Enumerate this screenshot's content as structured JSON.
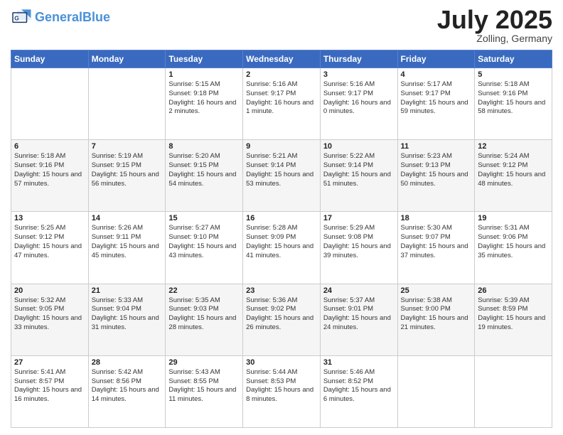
{
  "logo": {
    "line1": "General",
    "line2": "Blue"
  },
  "title": "July 2025",
  "location": "Zolling, Germany",
  "days_of_week": [
    "Sunday",
    "Monday",
    "Tuesday",
    "Wednesday",
    "Thursday",
    "Friday",
    "Saturday"
  ],
  "weeks": [
    [
      {
        "day": "",
        "text": ""
      },
      {
        "day": "",
        "text": ""
      },
      {
        "day": "1",
        "text": "Sunrise: 5:15 AM\nSunset: 9:18 PM\nDaylight: 16 hours\nand 2 minutes."
      },
      {
        "day": "2",
        "text": "Sunrise: 5:16 AM\nSunset: 9:17 PM\nDaylight: 16 hours\nand 1 minute."
      },
      {
        "day": "3",
        "text": "Sunrise: 5:16 AM\nSunset: 9:17 PM\nDaylight: 16 hours\nand 0 minutes."
      },
      {
        "day": "4",
        "text": "Sunrise: 5:17 AM\nSunset: 9:17 PM\nDaylight: 15 hours\nand 59 minutes."
      },
      {
        "day": "5",
        "text": "Sunrise: 5:18 AM\nSunset: 9:16 PM\nDaylight: 15 hours\nand 58 minutes."
      }
    ],
    [
      {
        "day": "6",
        "text": "Sunrise: 5:18 AM\nSunset: 9:16 PM\nDaylight: 15 hours\nand 57 minutes."
      },
      {
        "day": "7",
        "text": "Sunrise: 5:19 AM\nSunset: 9:15 PM\nDaylight: 15 hours\nand 56 minutes."
      },
      {
        "day": "8",
        "text": "Sunrise: 5:20 AM\nSunset: 9:15 PM\nDaylight: 15 hours\nand 54 minutes."
      },
      {
        "day": "9",
        "text": "Sunrise: 5:21 AM\nSunset: 9:14 PM\nDaylight: 15 hours\nand 53 minutes."
      },
      {
        "day": "10",
        "text": "Sunrise: 5:22 AM\nSunset: 9:14 PM\nDaylight: 15 hours\nand 51 minutes."
      },
      {
        "day": "11",
        "text": "Sunrise: 5:23 AM\nSunset: 9:13 PM\nDaylight: 15 hours\nand 50 minutes."
      },
      {
        "day": "12",
        "text": "Sunrise: 5:24 AM\nSunset: 9:12 PM\nDaylight: 15 hours\nand 48 minutes."
      }
    ],
    [
      {
        "day": "13",
        "text": "Sunrise: 5:25 AM\nSunset: 9:12 PM\nDaylight: 15 hours\nand 47 minutes."
      },
      {
        "day": "14",
        "text": "Sunrise: 5:26 AM\nSunset: 9:11 PM\nDaylight: 15 hours\nand 45 minutes."
      },
      {
        "day": "15",
        "text": "Sunrise: 5:27 AM\nSunset: 9:10 PM\nDaylight: 15 hours\nand 43 minutes."
      },
      {
        "day": "16",
        "text": "Sunrise: 5:28 AM\nSunset: 9:09 PM\nDaylight: 15 hours\nand 41 minutes."
      },
      {
        "day": "17",
        "text": "Sunrise: 5:29 AM\nSunset: 9:08 PM\nDaylight: 15 hours\nand 39 minutes."
      },
      {
        "day": "18",
        "text": "Sunrise: 5:30 AM\nSunset: 9:07 PM\nDaylight: 15 hours\nand 37 minutes."
      },
      {
        "day": "19",
        "text": "Sunrise: 5:31 AM\nSunset: 9:06 PM\nDaylight: 15 hours\nand 35 minutes."
      }
    ],
    [
      {
        "day": "20",
        "text": "Sunrise: 5:32 AM\nSunset: 9:05 PM\nDaylight: 15 hours\nand 33 minutes."
      },
      {
        "day": "21",
        "text": "Sunrise: 5:33 AM\nSunset: 9:04 PM\nDaylight: 15 hours\nand 31 minutes."
      },
      {
        "day": "22",
        "text": "Sunrise: 5:35 AM\nSunset: 9:03 PM\nDaylight: 15 hours\nand 28 minutes."
      },
      {
        "day": "23",
        "text": "Sunrise: 5:36 AM\nSunset: 9:02 PM\nDaylight: 15 hours\nand 26 minutes."
      },
      {
        "day": "24",
        "text": "Sunrise: 5:37 AM\nSunset: 9:01 PM\nDaylight: 15 hours\nand 24 minutes."
      },
      {
        "day": "25",
        "text": "Sunrise: 5:38 AM\nSunset: 9:00 PM\nDaylight: 15 hours\nand 21 minutes."
      },
      {
        "day": "26",
        "text": "Sunrise: 5:39 AM\nSunset: 8:59 PM\nDaylight: 15 hours\nand 19 minutes."
      }
    ],
    [
      {
        "day": "27",
        "text": "Sunrise: 5:41 AM\nSunset: 8:57 PM\nDaylight: 15 hours\nand 16 minutes."
      },
      {
        "day": "28",
        "text": "Sunrise: 5:42 AM\nSunset: 8:56 PM\nDaylight: 15 hours\nand 14 minutes."
      },
      {
        "day": "29",
        "text": "Sunrise: 5:43 AM\nSunset: 8:55 PM\nDaylight: 15 hours\nand 11 minutes."
      },
      {
        "day": "30",
        "text": "Sunrise: 5:44 AM\nSunset: 8:53 PM\nDaylight: 15 hours\nand 8 minutes."
      },
      {
        "day": "31",
        "text": "Sunrise: 5:46 AM\nSunset: 8:52 PM\nDaylight: 15 hours\nand 6 minutes."
      },
      {
        "day": "",
        "text": ""
      },
      {
        "day": "",
        "text": ""
      }
    ]
  ]
}
